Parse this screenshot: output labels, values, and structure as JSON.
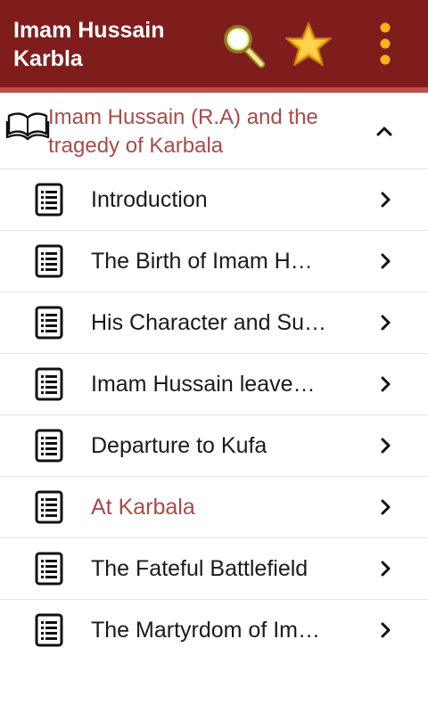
{
  "app": {
    "title": "Imam Hussain Karbla",
    "accent_color": "#7f1d1d",
    "active_color": "#a94a4a"
  },
  "toolbar": {
    "search_icon": "search-icon",
    "favorite_icon": "star-icon",
    "menu_icon": "overflow-menu-icon"
  },
  "section": {
    "title": "Imam Hussain (R.A) and the tragedy of Karbala",
    "icon": "open-book-icon",
    "expanded": true
  },
  "chapters": [
    {
      "label": "Introduction",
      "active": false
    },
    {
      "label": "The Birth of Imam H…",
      "active": false
    },
    {
      "label": "His Character and Su…",
      "active": false
    },
    {
      "label": "Imam Hussain leave…",
      "active": false
    },
    {
      "label": "Departure to Kufa",
      "active": false
    },
    {
      "label": "At Karbala",
      "active": true
    },
    {
      "label": "The Fateful Battlefield",
      "active": false
    },
    {
      "label": "The Martyrdom of Im…",
      "active": false
    }
  ]
}
